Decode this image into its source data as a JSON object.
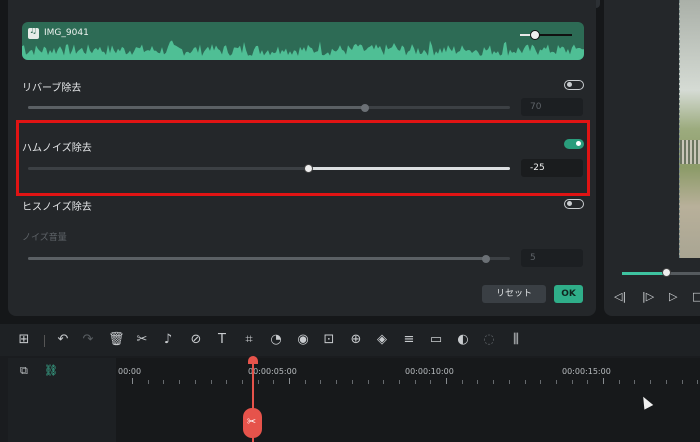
{
  "audio_clip": {
    "name": "IMG_9041"
  },
  "reverb": {
    "label": "リバーブ除去",
    "enabled": false,
    "value": "70",
    "level": 0.7
  },
  "hum": {
    "label": "ハムノイズ除去",
    "enabled": true,
    "value": "-25",
    "level": 0.58
  },
  "hiss": {
    "label": "ヒスノイズ除去",
    "enabled": false
  },
  "noise_volume": {
    "label": "ノイズ音量",
    "value": "5",
    "level": 0.95
  },
  "buttons": {
    "reset": "リセット",
    "ok": "OK"
  },
  "playback": {
    "progress": 0.56
  },
  "timeline": {
    "labels": [
      "00:00",
      "00:00:05:00",
      "00:00:10:00",
      "00:00:15:00"
    ]
  },
  "colors": {
    "accent": "#2fae89",
    "highlight": "#e01414",
    "playhead": "#e6534b"
  }
}
